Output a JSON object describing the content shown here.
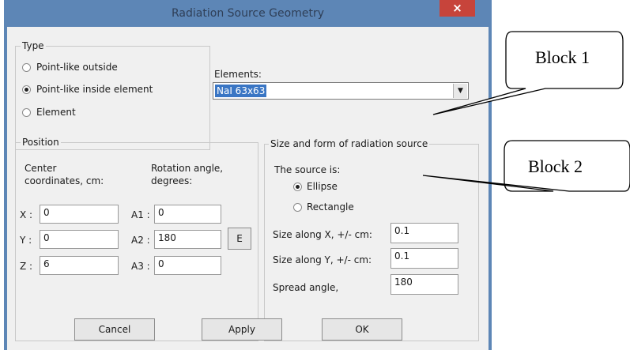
{
  "window": {
    "title": "Radiation Source Geometry",
    "close_glyph": "×"
  },
  "type_group": {
    "legend": "Type",
    "options": [
      {
        "label": "Point-like outside",
        "selected": false
      },
      {
        "label": "Point-like inside element",
        "selected": true
      },
      {
        "label": "Element",
        "selected": false
      }
    ]
  },
  "elements": {
    "label": "Elements:",
    "value": "NaI 63x63"
  },
  "position": {
    "legend": "Position",
    "center_header": "Center\ncoordinates, cm:",
    "center_header_line1": "Center",
    "center_header_line2": "coordinates, cm:",
    "rotation_header_line1": "Rotation angle,",
    "rotation_header_line2": "degrees:",
    "x_label": "X :",
    "x_value": "0",
    "y_label": "Y :",
    "y_value": "0",
    "z_label": "Z :",
    "z_value": "6",
    "a1_label": "A1 :",
    "a1_value": "0",
    "a2_label": "A2 :",
    "a2_value": "180",
    "a3_label": "A3 :",
    "a3_value": "0",
    "e_button": "E"
  },
  "size_form": {
    "legend": "Size and form of radiation source",
    "source_is": "The source is:",
    "options": [
      {
        "label": "Ellipse",
        "selected": true
      },
      {
        "label": "Rectangle",
        "selected": false
      }
    ],
    "size_x_label": "Size along X, +/- cm:",
    "size_x_value": "0.1",
    "size_y_label": "Size along Y, +/- cm:",
    "size_y_value": "0.1",
    "spread_label": "Spread angle,",
    "spread_value": "180"
  },
  "buttons": {
    "cancel": "Cancel",
    "apply": "Apply",
    "ok": "OK"
  },
  "callouts": {
    "block1": "Block 1",
    "block2": "Block 2"
  }
}
